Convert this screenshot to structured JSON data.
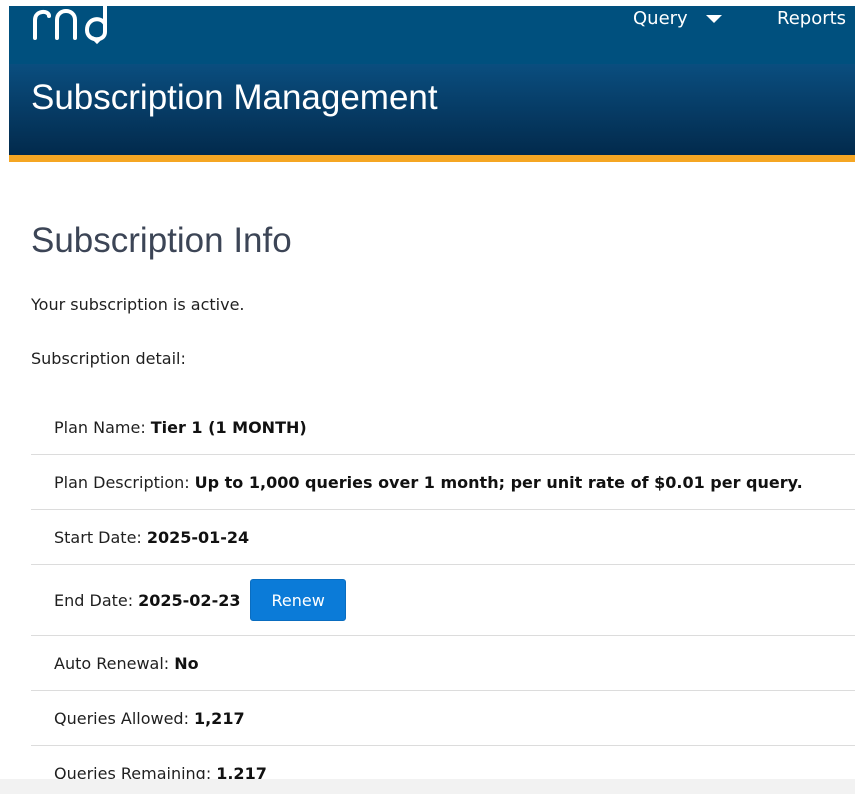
{
  "nav": {
    "logo_text": "rnd",
    "query_label": "Query",
    "reports_label": "Reports"
  },
  "header": {
    "title": "Subscription Management"
  },
  "main": {
    "heading": "Subscription Info",
    "status_text": "Your subscription is active.",
    "detail_label": "Subscription detail:",
    "details": [
      {
        "key": "Plan Name:",
        "value": "Tier 1 (1 MONTH)"
      },
      {
        "key": "Plan Description:",
        "value": "Up to 1,000 queries over 1 month; per unit rate of $0.01 per query."
      },
      {
        "key": "Start Date:",
        "value": "2025-01-24"
      },
      {
        "key": "End Date:",
        "value": "2025-02-23",
        "action_label": "Renew"
      },
      {
        "key": "Auto Renewal:",
        "value": "No"
      },
      {
        "key": "Queries Allowed:",
        "value": "1,217"
      },
      {
        "key": "Queries Remaining:",
        "value": "1,217"
      }
    ]
  },
  "colors": {
    "nav_bg": "#00507e",
    "header_bg": "#063a63",
    "accent": "#f5a623",
    "button": "#0b7bd8",
    "heading_text": "#3c4556"
  },
  "icons": {
    "query_dropdown": "caret-down-icon"
  }
}
